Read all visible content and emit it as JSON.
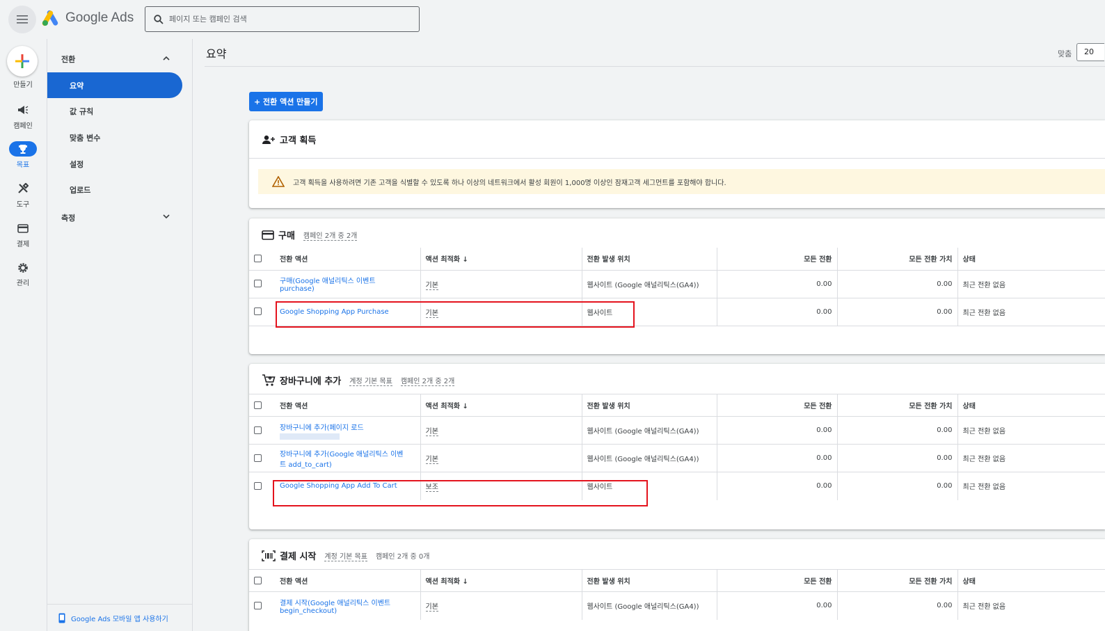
{
  "app": {
    "name": "Google Ads",
    "search_placeholder": "페이지 또는 캠페인 검색"
  },
  "rail": [
    {
      "label": "만들기",
      "icon": "plus-icon"
    },
    {
      "label": "캠페인",
      "icon": "megaphone-icon"
    },
    {
      "label": "목표",
      "icon": "trophy-icon",
      "active": true
    },
    {
      "label": "도구",
      "icon": "tools-icon"
    },
    {
      "label": "결제",
      "icon": "credit-card-icon"
    },
    {
      "label": "관리",
      "icon": "gear-icon"
    }
  ],
  "sidebar": {
    "section1": "전환",
    "items": [
      "요약",
      "값 규칙",
      "맞춤 변수",
      "설정",
      "업로드"
    ],
    "section2": "측정",
    "bottom_link": "Google Ads 모바일 앱 사용하기"
  },
  "header": {
    "title": "요약",
    "fit_label": "맞춤",
    "fit_value": "20"
  },
  "create_action_label": "+ 전환 액션 만들기",
  "acquisition": {
    "title": "고객 획득",
    "warning": "고객 획득을 사용하려면 기존 고객을 식별할 수 있도록 하나 이상의 네트워크에서 활성 회원이 1,000명 이상인 잠재고객 세그먼트를 포함해야 합니다."
  },
  "columns": [
    "전환 액션",
    "액션 최적화",
    "전환 발생 위치",
    "모든 전환",
    "모든 전환 가치",
    "상태"
  ],
  "purchase": {
    "title": "구매",
    "meta1": "캠페인 2개 중 2개",
    "rows": [
      {
        "action_l1": "구매(Google 애널리틱스 이벤트",
        "action_l2": "purchase)",
        "opt": "기본",
        "source": "웹사이트 (Google 애널리틱스(GA4))",
        "conv": "0.00",
        "value": "0.00",
        "status": "최근 전환 없음"
      },
      {
        "action_l1": "Google Shopping App Purchase",
        "action_l2": "",
        "opt": "기본",
        "source": "웹사이트",
        "conv": "0.00",
        "value": "0.00",
        "status": "최근 전환 없음"
      }
    ]
  },
  "cart": {
    "title": "장바구니에 추가",
    "meta1": "계정 기본 목표",
    "meta2": "캠페인 2개 중 2개",
    "rows": [
      {
        "action_l1": "장바구니에 추가(페이지 로드",
        "action_l2": "",
        "opt": "기본",
        "source": "웹사이트 (Google 애널리틱스(GA4))",
        "conv": "0.00",
        "value": "0.00",
        "status": "최근 전환 없음"
      },
      {
        "action_l1": "장바구니에 추가(Google 애널리틱스 이벤",
        "action_l2": "트 add_to_cart)",
        "opt": "기본",
        "source": "웹사이트 (Google 애널리틱스(GA4))",
        "conv": "0.00",
        "value": "0.00",
        "status": "최근 전환 없음"
      },
      {
        "action_l1": "Google Shopping App Add To Cart",
        "action_l2": "",
        "opt": "보조",
        "source": "웹사이트",
        "conv": "0.00",
        "value": "0.00",
        "status": "최근 전환 없음"
      }
    ]
  },
  "checkout": {
    "title": "결제 시작",
    "meta1": "계정 기본 목표",
    "meta2": "캠페인 2개 중 0개",
    "rows": [
      {
        "action_l1": "결제 시작(Google 애널리틱스 이벤트",
        "action_l2": "begin_checkout)",
        "opt": "기본",
        "source": "웹사이트 (Google 애널리틱스(GA4))",
        "conv": "0.00",
        "value": "0.00",
        "status": "최근 전환 없음"
      }
    ]
  },
  "colors": {
    "accent": "#1a73e8",
    "highlight": "#e4131d",
    "warning_bg": "#fef7e0"
  }
}
